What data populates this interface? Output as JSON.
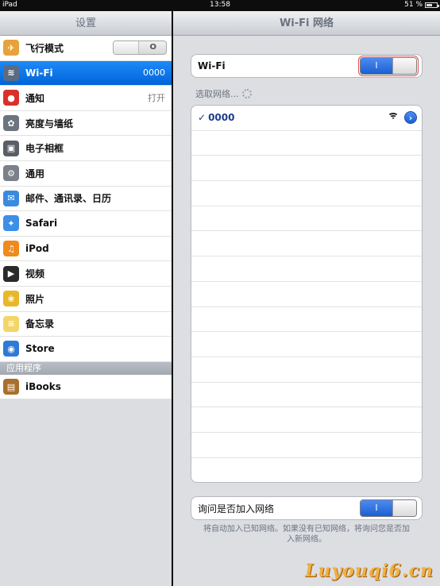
{
  "status_bar": {
    "device": "iPad",
    "time": "13:58",
    "battery": "51 %",
    "battery_level": 0.51
  },
  "left_panel": {
    "title": "设置",
    "items": [
      {
        "label": "飞行模式",
        "icon": "airplane-icon",
        "icon_color": "#e8a23b",
        "control": "switch",
        "switch_mark": "O"
      },
      {
        "label": "Wi-Fi",
        "icon": "wifi-icon",
        "icon_color": "#5b6b80",
        "value": "0000",
        "selected": true
      },
      {
        "label": "通知",
        "icon": "notifications-icon",
        "icon_color": "#d9302b",
        "value": "打开"
      },
      {
        "label": "亮度与墙纸",
        "icon": "brightness-icon",
        "icon_color": "#6b7480"
      },
      {
        "label": "电子相框",
        "icon": "picture-frame-icon",
        "icon_color": "#5a5f66"
      },
      {
        "label": "通用",
        "icon": "gear-icon",
        "icon_color": "#7b8089"
      },
      {
        "label": "邮件、通讯录、日历",
        "icon": "mail-icon",
        "icon_color": "#3a8be0"
      },
      {
        "label": "Safari",
        "icon": "compass-icon",
        "icon_color": "#3d8ee8"
      },
      {
        "label": "iPod",
        "icon": "ipod-icon",
        "icon_color": "#f08a1c"
      },
      {
        "label": "视频",
        "icon": "video-icon",
        "icon_color": "#2a2a2a"
      },
      {
        "label": "照片",
        "icon": "sunflower-icon",
        "icon_color": "#e8b72a"
      },
      {
        "label": "备忘录",
        "icon": "notes-icon",
        "icon_color": "#f2d66a"
      },
      {
        "label": "Store",
        "icon": "store-icon",
        "icon_color": "#2f7ad6"
      }
    ],
    "section_header": "应用程序",
    "apps": [
      {
        "label": "iBooks",
        "icon": "ibooks-icon",
        "icon_color": "#a8702e"
      }
    ]
  },
  "right_panel": {
    "title": "Wi-Fi 网络",
    "wifi_label": "Wi-Fi",
    "wifi_switch_mark": "I",
    "choose_label": "选取网络...",
    "networks": [
      {
        "name": "0000",
        "connected": true,
        "check": "✓",
        "disclosure": "›"
      }
    ],
    "empty_rows": 14,
    "ask_label": "询问是否加入网络",
    "ask_switch_mark": "I",
    "footnote": "将自动加入已知网络。如果没有已知网络，将询问您是否加入新网络。"
  },
  "watermark": "Luyouqi6.cn",
  "colors": {
    "accent": "#0a6ee0",
    "switch_on": "#2a6fdc",
    "highlight_outline": "#d9534f"
  }
}
